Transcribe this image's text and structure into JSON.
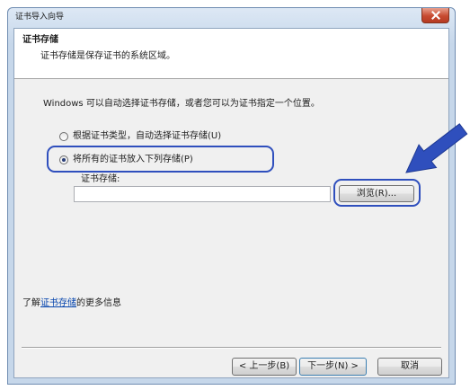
{
  "window": {
    "title": "证书导入向导"
  },
  "icons": {
    "close": "close-icon",
    "annotation": "arrow-annotation"
  },
  "header": {
    "title": "证书存储",
    "subtitle": "证书存储是保存证书的系统区域。"
  },
  "body": {
    "intro": "Windows 可以自动选择证书存储，或者您可以为证书指定一个位置。",
    "options": [
      {
        "label": "根据证书类型，自动选择证书存储(U)",
        "selected": false
      },
      {
        "label": "将所有的证书放入下列存储(P)",
        "selected": true
      }
    ],
    "store_label": "证书存储:",
    "store_value": "",
    "browse_label": "浏览(R)..."
  },
  "footer": {
    "learn_prefix": "了解",
    "learn_link": "证书存储",
    "learn_suffix": "的更多信息"
  },
  "buttons": {
    "back": "< 上一步(B)",
    "next": "下一步(N) >",
    "cancel": "取消"
  },
  "colors": {
    "annotation": "#2f4fbd",
    "link": "#0645ad",
    "close": "#c74a30"
  }
}
